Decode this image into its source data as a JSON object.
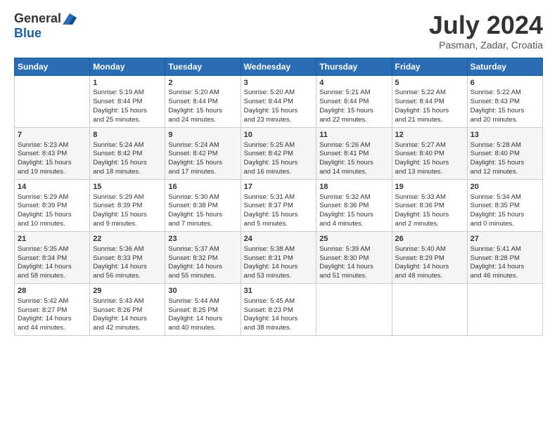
{
  "header": {
    "logo_general": "General",
    "logo_blue": "Blue",
    "month_title": "July 2024",
    "location": "Pasman, Zadar, Croatia"
  },
  "calendar": {
    "headers": [
      "Sunday",
      "Monday",
      "Tuesday",
      "Wednesday",
      "Thursday",
      "Friday",
      "Saturday"
    ],
    "weeks": [
      [
        {
          "day": "",
          "info": ""
        },
        {
          "day": "1",
          "info": "Sunrise: 5:19 AM\nSunset: 8:44 PM\nDaylight: 15 hours\nand 25 minutes."
        },
        {
          "day": "2",
          "info": "Sunrise: 5:20 AM\nSunset: 8:44 PM\nDaylight: 15 hours\nand 24 minutes."
        },
        {
          "day": "3",
          "info": "Sunrise: 5:20 AM\nSunset: 8:44 PM\nDaylight: 15 hours\nand 23 minutes."
        },
        {
          "day": "4",
          "info": "Sunrise: 5:21 AM\nSunset: 8:44 PM\nDaylight: 15 hours\nand 22 minutes."
        },
        {
          "day": "5",
          "info": "Sunrise: 5:22 AM\nSunset: 8:44 PM\nDaylight: 15 hours\nand 21 minutes."
        },
        {
          "day": "6",
          "info": "Sunrise: 5:22 AM\nSunset: 8:43 PM\nDaylight: 15 hours\nand 20 minutes."
        }
      ],
      [
        {
          "day": "7",
          "info": "Sunrise: 5:23 AM\nSunset: 8:43 PM\nDaylight: 15 hours\nand 19 minutes."
        },
        {
          "day": "8",
          "info": "Sunrise: 5:24 AM\nSunset: 8:42 PM\nDaylight: 15 hours\nand 18 minutes."
        },
        {
          "day": "9",
          "info": "Sunrise: 5:24 AM\nSunset: 8:42 PM\nDaylight: 15 hours\nand 17 minutes."
        },
        {
          "day": "10",
          "info": "Sunrise: 5:25 AM\nSunset: 8:42 PM\nDaylight: 15 hours\nand 16 minutes."
        },
        {
          "day": "11",
          "info": "Sunrise: 5:26 AM\nSunset: 8:41 PM\nDaylight: 15 hours\nand 14 minutes."
        },
        {
          "day": "12",
          "info": "Sunrise: 5:27 AM\nSunset: 8:40 PM\nDaylight: 15 hours\nand 13 minutes."
        },
        {
          "day": "13",
          "info": "Sunrise: 5:28 AM\nSunset: 8:40 PM\nDaylight: 15 hours\nand 12 minutes."
        }
      ],
      [
        {
          "day": "14",
          "info": "Sunrise: 5:29 AM\nSunset: 8:39 PM\nDaylight: 15 hours\nand 10 minutes."
        },
        {
          "day": "15",
          "info": "Sunrise: 5:29 AM\nSunset: 8:39 PM\nDaylight: 15 hours\nand 9 minutes."
        },
        {
          "day": "16",
          "info": "Sunrise: 5:30 AM\nSunset: 8:38 PM\nDaylight: 15 hours\nand 7 minutes."
        },
        {
          "day": "17",
          "info": "Sunrise: 5:31 AM\nSunset: 8:37 PM\nDaylight: 15 hours\nand 5 minutes."
        },
        {
          "day": "18",
          "info": "Sunrise: 5:32 AM\nSunset: 8:36 PM\nDaylight: 15 hours\nand 4 minutes."
        },
        {
          "day": "19",
          "info": "Sunrise: 5:33 AM\nSunset: 8:36 PM\nDaylight: 15 hours\nand 2 minutes."
        },
        {
          "day": "20",
          "info": "Sunrise: 5:34 AM\nSunset: 8:35 PM\nDaylight: 15 hours\nand 0 minutes."
        }
      ],
      [
        {
          "day": "21",
          "info": "Sunrise: 5:35 AM\nSunset: 8:34 PM\nDaylight: 14 hours\nand 58 minutes."
        },
        {
          "day": "22",
          "info": "Sunrise: 5:36 AM\nSunset: 8:33 PM\nDaylight: 14 hours\nand 56 minutes."
        },
        {
          "day": "23",
          "info": "Sunrise: 5:37 AM\nSunset: 8:32 PM\nDaylight: 14 hours\nand 55 minutes."
        },
        {
          "day": "24",
          "info": "Sunrise: 5:38 AM\nSunset: 8:31 PM\nDaylight: 14 hours\nand 53 minutes."
        },
        {
          "day": "25",
          "info": "Sunrise: 5:39 AM\nSunset: 8:30 PM\nDaylight: 14 hours\nand 51 minutes."
        },
        {
          "day": "26",
          "info": "Sunrise: 5:40 AM\nSunset: 8:29 PM\nDaylight: 14 hours\nand 48 minutes."
        },
        {
          "day": "27",
          "info": "Sunrise: 5:41 AM\nSunset: 8:28 PM\nDaylight: 14 hours\nand 46 minutes."
        }
      ],
      [
        {
          "day": "28",
          "info": "Sunrise: 5:42 AM\nSunset: 8:27 PM\nDaylight: 14 hours\nand 44 minutes."
        },
        {
          "day": "29",
          "info": "Sunrise: 5:43 AM\nSunset: 8:26 PM\nDaylight: 14 hours\nand 42 minutes."
        },
        {
          "day": "30",
          "info": "Sunrise: 5:44 AM\nSunset: 8:25 PM\nDaylight: 14 hours\nand 40 minutes."
        },
        {
          "day": "31",
          "info": "Sunrise: 5:45 AM\nSunset: 8:23 PM\nDaylight: 14 hours\nand 38 minutes."
        },
        {
          "day": "",
          "info": ""
        },
        {
          "day": "",
          "info": ""
        },
        {
          "day": "",
          "info": ""
        }
      ]
    ]
  }
}
